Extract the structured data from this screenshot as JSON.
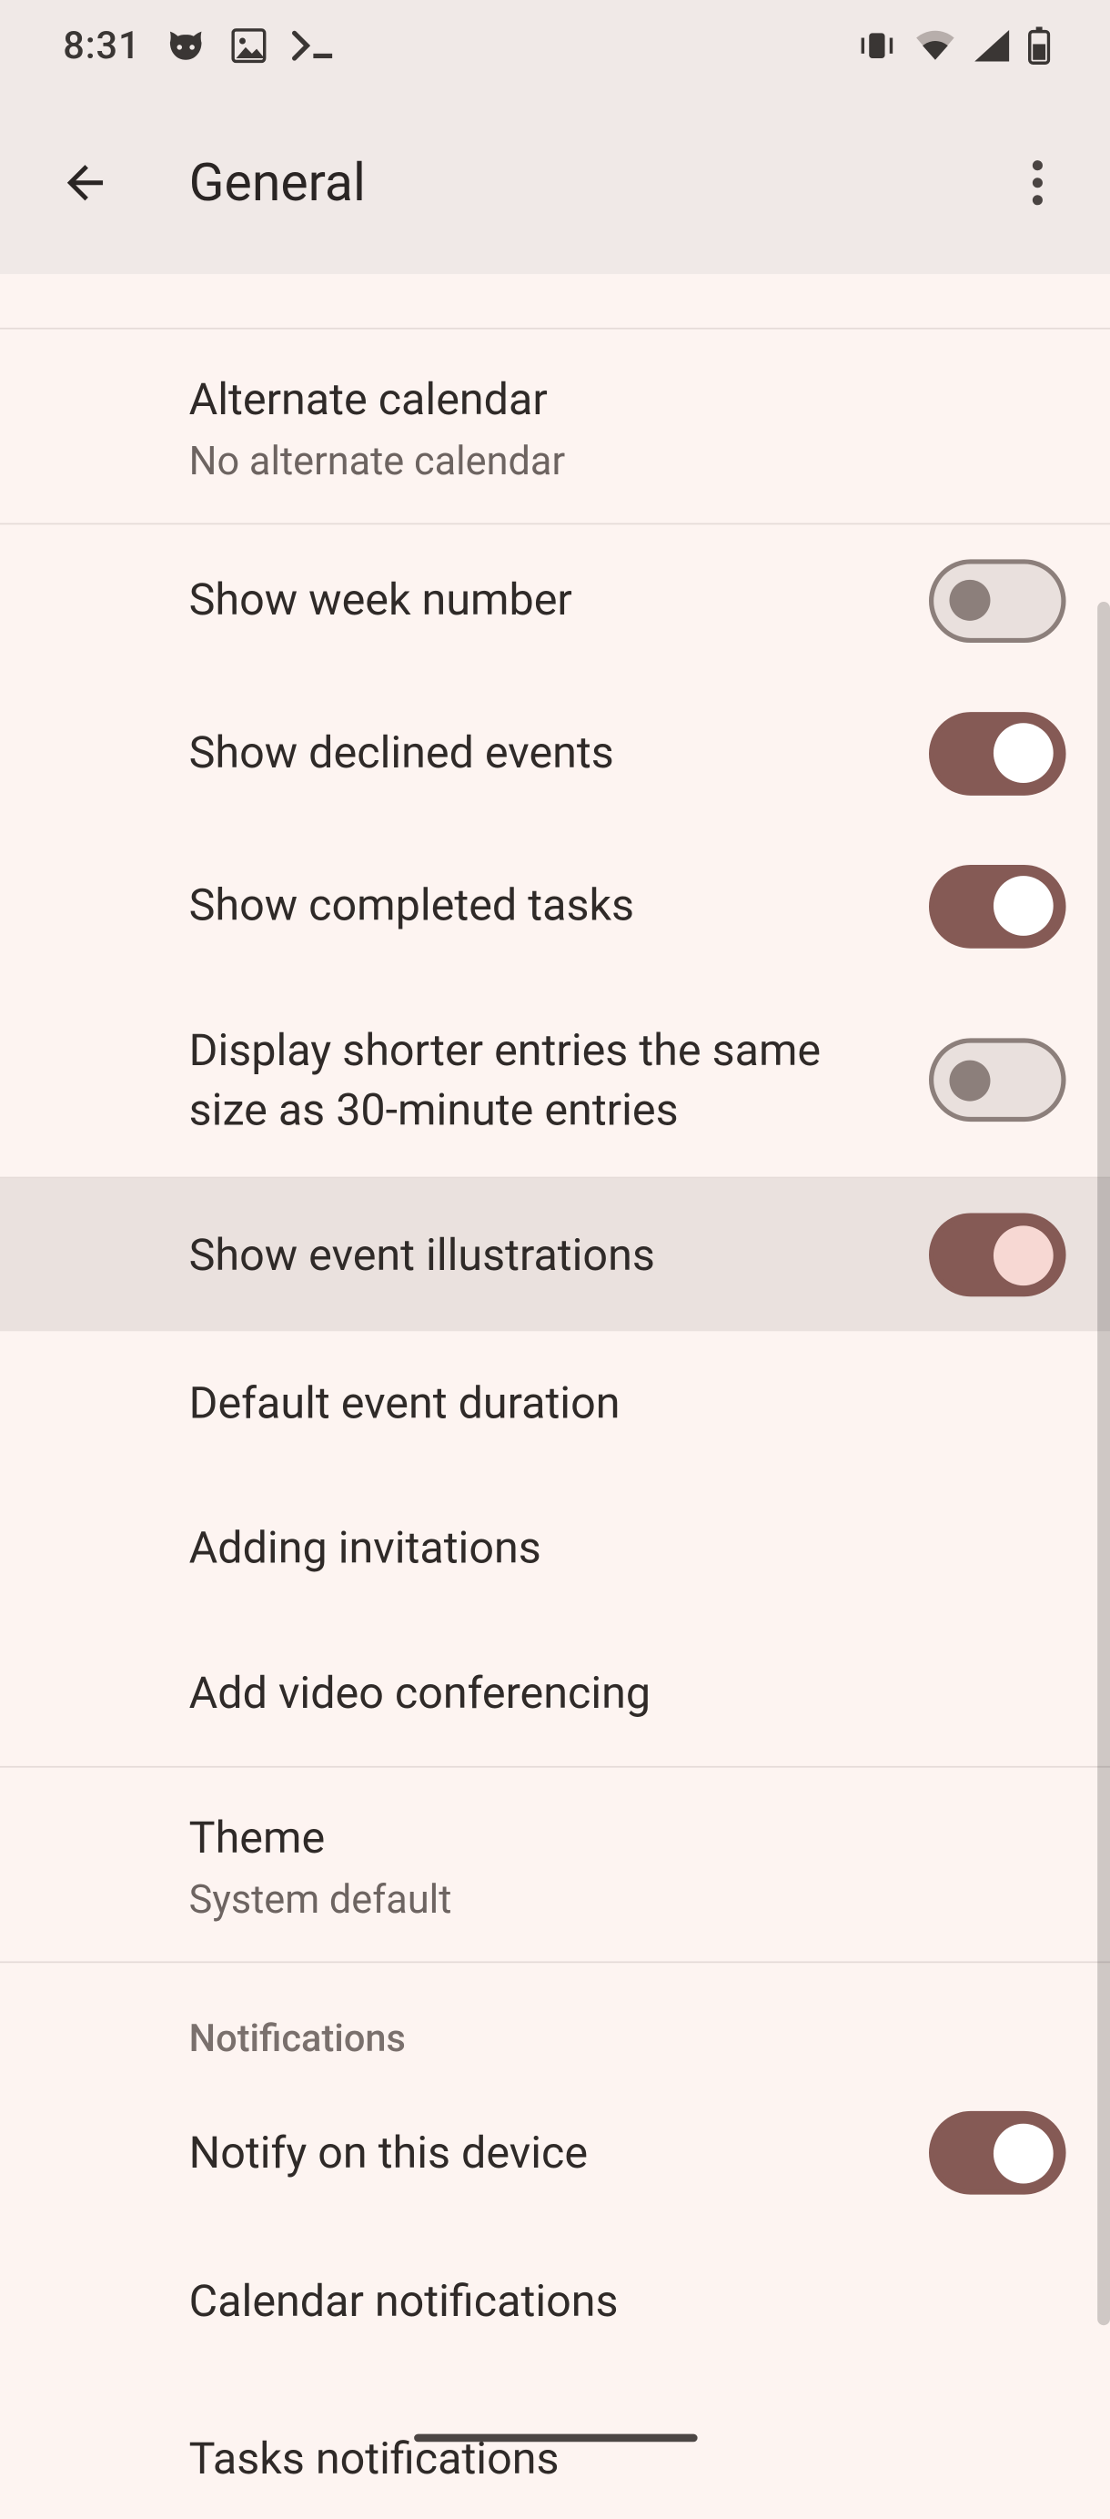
{
  "status": {
    "time": "8:31"
  },
  "appbar": {
    "title": "General"
  },
  "rows": {
    "alternate_calendar": {
      "label": "Alternate calendar",
      "sub": "No alternate calendar"
    },
    "show_week_number": {
      "label": "Show week number"
    },
    "show_declined_events": {
      "label": "Show declined events"
    },
    "show_completed_tasks": {
      "label": "Show completed tasks"
    },
    "display_shorter_entries": {
      "label": "Display shorter entries the same size as 30-minute entries"
    },
    "show_event_illustrations": {
      "label": "Show event illustrations"
    },
    "default_event_duration": {
      "label": "Default event duration"
    },
    "adding_invitations": {
      "label": "Adding invitations"
    },
    "add_video_conferencing": {
      "label": "Add video conferencing"
    },
    "theme": {
      "label": "Theme",
      "sub": "System default"
    },
    "notify_on_this_device": {
      "label": "Notify on this device"
    },
    "calendar_notifications": {
      "label": "Calendar notifications"
    },
    "tasks_notifications": {
      "label": "Tasks notifications"
    }
  },
  "sections": {
    "notifications": "Notifications"
  },
  "switches": {
    "show_week_number": false,
    "show_declined_events": true,
    "show_completed_tasks": true,
    "display_shorter_entries": false,
    "show_event_illustrations": true,
    "notify_on_this_device": true
  }
}
